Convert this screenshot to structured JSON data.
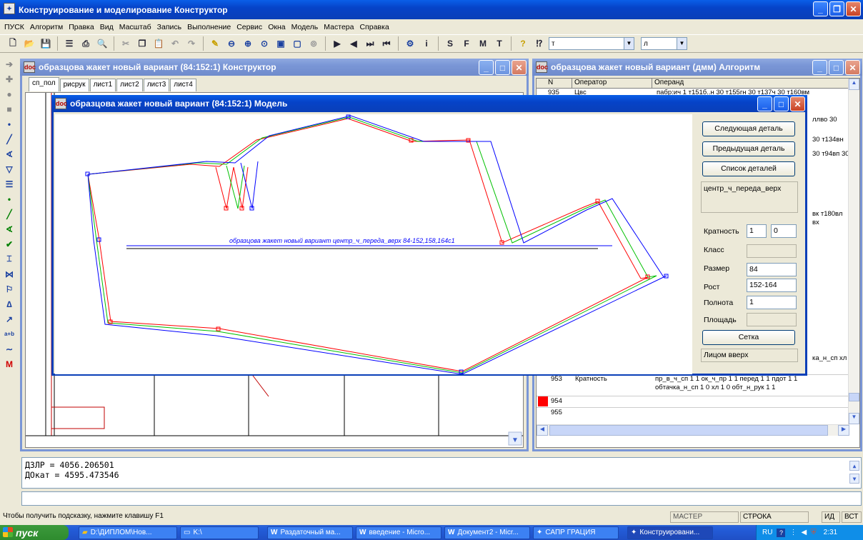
{
  "app": {
    "title": "Конструирование и моделирование  Конструктор",
    "icon": "app-logo-icon"
  },
  "menu": [
    "ПУСК",
    "Алгоритм",
    "Правка",
    "Вид",
    "Масштаб",
    "Запись",
    "Выполнение",
    "Сервис",
    "Окна",
    "Модель",
    "Мастера",
    "Справка"
  ],
  "toolbar": {
    "letters": [
      "S",
      "F",
      "M",
      "T"
    ],
    "combo1_value": "т",
    "combo2_value": "л",
    "info_label": "i"
  },
  "left_toolbar": {
    "text_tool": "a+b",
    "m_tool": "M"
  },
  "constructor_window": {
    "title": "образцова жакет новый вариант (84:152:1) Конструктор",
    "tabs": [
      "сп_пол",
      "рисрук",
      "лист1",
      "лист2",
      "лист3",
      "лист4"
    ]
  },
  "algorithm_window": {
    "title": "образцова жакет новый вариант (дмм) Алгоритм",
    "columns": [
      "N",
      "Оператор",
      "Операнд"
    ],
    "rows": [
      {
        "n": "935",
        "op": "Цвс",
        "operand": "пабр:ич 1 т151б..н 30 т155гн 30 т137ч 30 т160вм"
      },
      {
        "n": "",
        "op": "",
        "operand": "ллво 30"
      },
      {
        "n": "",
        "op": "",
        "operand": "30 т134вн"
      },
      {
        "n": "",
        "op": "",
        "operand": "30 т94вп 30"
      },
      {
        "n": "",
        "op": "",
        "operand": "вк т180вл"
      },
      {
        "n": "",
        "op": "",
        "operand": "вх"
      },
      {
        "n": "",
        "op": "",
        "operand": "ка_н_сп хл"
      },
      {
        "n": "953",
        "op": "Кратность",
        "operand": "пр_в_ч_сп 1 1 ок_ч_пр 1 1 перед 1 1 пдот 1 1"
      },
      {
        "n": "",
        "op": "",
        "operand": "обтачка_н_сп 1 0 хл 1 0 обт_н_рук 1 1"
      },
      {
        "n": "954",
        "op": "",
        "operand": ""
      },
      {
        "n": "955",
        "op": "",
        "operand": ""
      }
    ]
  },
  "model_window": {
    "title": "образцова жакет новый вариант (84:152:1) Модель",
    "piece_label": "образцова  жакет  новый  вариант  центр_ч_переда_верх     84-152,158,164с1",
    "buttons": {
      "next": "Следующая деталь",
      "prev": "Предыдущая деталь",
      "list": "Список деталей",
      "grid": "Сетка"
    },
    "detail_name": "центр_ч_переда_верх",
    "fields": {
      "kratnost_label": "Кратность",
      "kratnost_1": "1",
      "kratnost_2": "0",
      "klass_label": "Класс",
      "klass": "",
      "razmer_label": "Размер",
      "razmer": "84",
      "rost_label": "Рост",
      "rost": "152-164",
      "polnota_label": "Полнота",
      "polnota": "1",
      "ploshad_label": "Площадь",
      "ploshad": ""
    },
    "face_up": "Лицом вверх"
  },
  "output": {
    "line1": "ДЗЛР = 4056.206501",
    "line2": "ДОкат = 4595.473546"
  },
  "status": {
    "hint": "Чтобы получить подсказку, нажмите клавишу F1",
    "master": "МАСТЕР",
    "stroka": "СТРОКА",
    "id": "ИД",
    "vst": "ВСТ"
  },
  "taskbar": {
    "start": "пуск",
    "tasks": [
      "D:\\ДИПЛОМ\\Нов...",
      "K:\\",
      "Раздаточный ма...",
      "введение - Micro...",
      "Документ2 - Micr...",
      "САПР ГРАЦИЯ",
      "Конструировани..."
    ],
    "lang": "RU",
    "time": "2:31"
  },
  "colors": {
    "xp_blue": "#0a3fb8",
    "line_red": "#ff0000",
    "line_green": "#00c000",
    "line_blue": "#0000ff"
  }
}
